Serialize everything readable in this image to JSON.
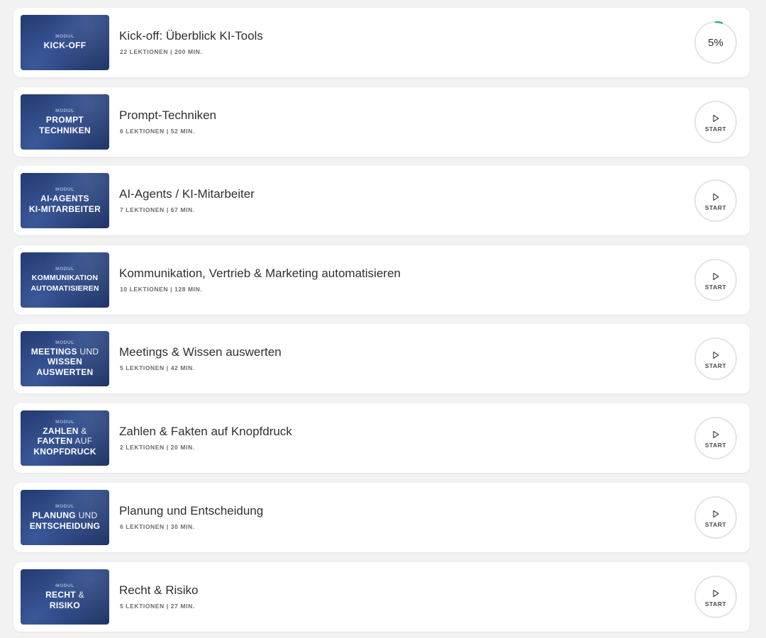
{
  "modules": [
    {
      "thumb_label": "MODUL",
      "thumb_lines": [
        [
          {
            "t": "KICK-OFF",
            "b": true
          }
        ]
      ],
      "title": "Kick-off: Überblick KI-Tools",
      "meta": "22 LEKTIONEN | 200 MIN.",
      "status": "progress",
      "progress_text": "5%",
      "progress_value": 0.05
    },
    {
      "thumb_label": "MODUL",
      "thumb_lines": [
        [
          {
            "t": "PROMPT",
            "b": true
          }
        ],
        [
          {
            "t": "TECHNIKEN",
            "b": true
          }
        ]
      ],
      "title": "Prompt-Techniken",
      "meta": "6 LEKTIONEN | 52 MIN.",
      "status": "start",
      "start_label": "START"
    },
    {
      "thumb_label": "MODUL",
      "thumb_lines": [
        [
          {
            "t": "AI-AGENTS",
            "b": true
          }
        ],
        [
          {
            "t": "KI-MITARBEITER",
            "b": true
          }
        ]
      ],
      "title": "AI-Agents / KI-Mitarbeiter",
      "meta": "7 LEKTIONEN | 67 MIN.",
      "status": "start",
      "start_label": "START"
    },
    {
      "thumb_label": "MODUL",
      "thumb_lines": [
        [
          {
            "t": "KOMMUNIKATION",
            "b": true
          }
        ],
        [
          {
            "t": "AUTOMATISIEREN",
            "b": true
          }
        ]
      ],
      "title": "Kommunikation, Vertrieb & Marketing automatisieren",
      "meta": "10 LEKTIONEN | 128 MIN.",
      "status": "start",
      "start_label": "START"
    },
    {
      "thumb_label": "MODUL",
      "thumb_lines": [
        [
          {
            "t": "MEETINGS",
            "b": true
          },
          {
            "t": " UND",
            "b": false
          }
        ],
        [
          {
            "t": "WISSEN",
            "b": true
          }
        ],
        [
          {
            "t": "AUSWERTEN",
            "b": true
          }
        ]
      ],
      "title": "Meetings & Wissen auswerten",
      "meta": "5 LEKTIONEN | 42 MIN.",
      "status": "start",
      "start_label": "START"
    },
    {
      "thumb_label": "MODUL",
      "thumb_lines": [
        [
          {
            "t": "ZAHLEN",
            "b": true
          },
          {
            "t": " &",
            "b": false
          }
        ],
        [
          {
            "t": "FAKTEN",
            "b": true
          },
          {
            "t": " AUF",
            "b": false
          }
        ],
        [
          {
            "t": "KNOPFDRUCK",
            "b": true
          }
        ]
      ],
      "title": "Zahlen & Fakten auf Knopfdruck",
      "meta": "2 LEKTIONEN | 20 MIN.",
      "status": "start",
      "start_label": "START"
    },
    {
      "thumb_label": "MODUL",
      "thumb_lines": [
        [
          {
            "t": "PLANUNG",
            "b": true
          },
          {
            "t": " UND",
            "b": false
          }
        ],
        [
          {
            "t": "ENTSCHEIDUNG",
            "b": true
          }
        ]
      ],
      "title": "Planung und Entscheidung",
      "meta": "6 LEKTIONEN | 30 MIN.",
      "status": "start",
      "start_label": "START"
    },
    {
      "thumb_label": "MODUL",
      "thumb_lines": [
        [
          {
            "t": "RECHT",
            "b": true
          },
          {
            "t": " &",
            "b": false
          }
        ],
        [
          {
            "t": "RISIKO",
            "b": true
          }
        ]
      ],
      "title": "Recht & Risiko",
      "meta": "5 LEKTIONEN | 27 MIN.",
      "status": "start",
      "start_label": "START"
    }
  ],
  "colors": {
    "progress_accent": "#3daa6a",
    "thumb_blue": "#2d4a8a"
  },
  "icons": {
    "start": "play-icon"
  }
}
